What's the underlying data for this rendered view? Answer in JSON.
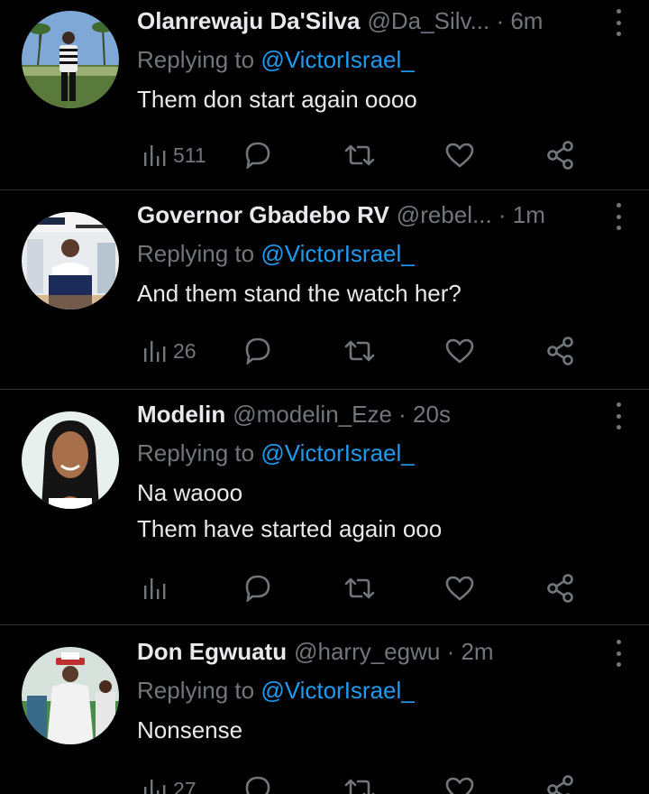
{
  "colors": {
    "background": "#000000",
    "text": "#e7e9ea",
    "muted": "#71767b",
    "link": "#1d9bf0",
    "divider": "#2f3336"
  },
  "tweets": [
    {
      "name": "Olanrewaju Da'Silva",
      "handle": "@Da_Silv... · 6m",
      "reply_prefix": "Replying to ",
      "reply_to": "@VictorIsrael_",
      "text": "Them don start again oooo",
      "views": "511",
      "avatar": "man-striped-shirt-palm-trees"
    },
    {
      "name": "Governor Gbadebo RV",
      "handle": "@rebel... · 1m",
      "reply_prefix": "Replying to ",
      "reply_to": "@VictorIsrael_",
      "text": "And them stand the watch her?",
      "views": "26",
      "avatar": "man-white-shirt-poster"
    },
    {
      "name": "Modelin",
      "handle": "@modelin_Eze · 20s",
      "reply_prefix": "Replying to ",
      "reply_to": "@VictorIsrael_",
      "text": "Na waooo\nThem have started again ooo",
      "views": "",
      "avatar": "smiling-woman"
    },
    {
      "name": "Don Egwuatu",
      "handle": "@harry_egwu · 2m",
      "reply_prefix": "Replying to ",
      "reply_to": "@VictorIsrael_",
      "text": "Nonsense",
      "views": "27",
      "avatar": "men-in-white-traditional-attire"
    }
  ],
  "icons": {
    "views": "bar-chart-icon",
    "reply": "speech-bubble-icon",
    "retweet": "retweet-icon",
    "like": "heart-icon",
    "share": "share-icon",
    "more": "more-vertical-icon"
  }
}
